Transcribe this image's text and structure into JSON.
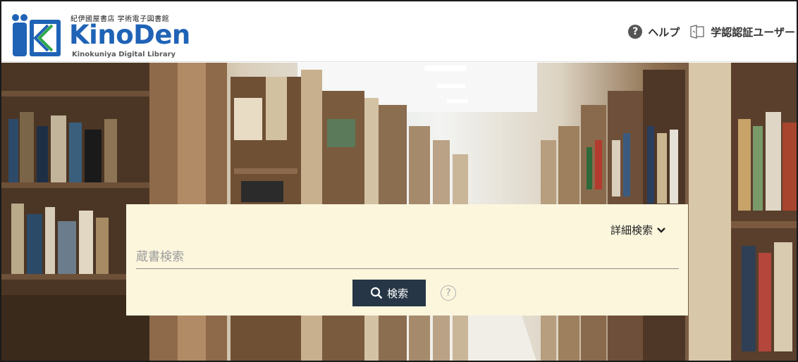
{
  "header": {
    "logo_subtitle": "紀伊國屋書店 学術電子図書館",
    "logo_name": "KinoDen",
    "logo_tagline": "Kinokuniya Digital Library",
    "help_label": "ヘルプ",
    "login_label": "学認認証ユーザー"
  },
  "search": {
    "advanced_label": "詳細検索",
    "placeholder": "蔵書検索",
    "button_label": "検索",
    "help_glyph": "?"
  },
  "colors": {
    "brand_blue": "#1f63b6",
    "panel_bg": "#fcf6dd",
    "button_bg": "#263646"
  }
}
